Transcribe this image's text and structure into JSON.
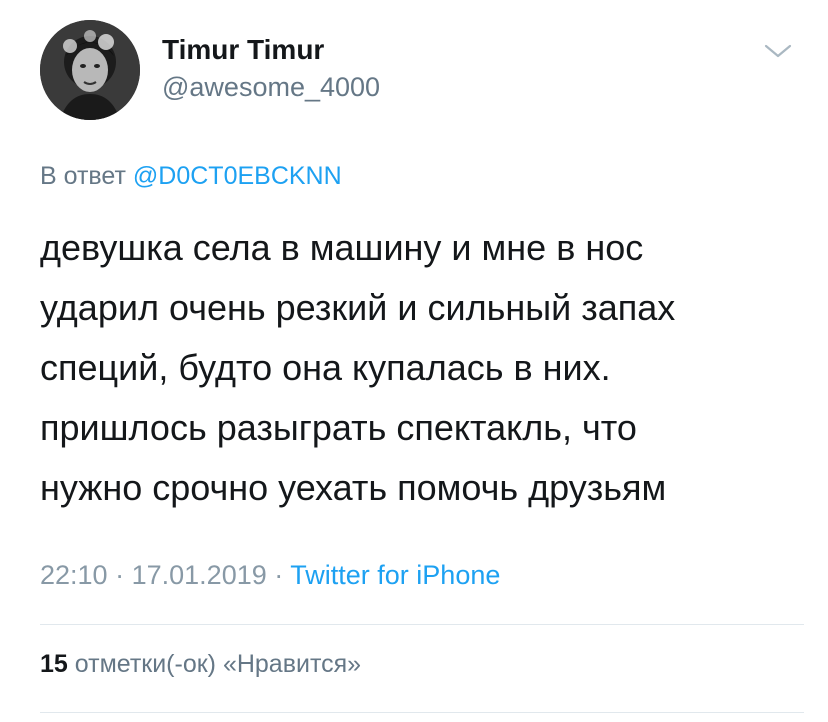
{
  "author": {
    "name": "Timur Timur",
    "handle": "@awesome_4000"
  },
  "reply": {
    "prefix": "В ответ",
    "mention": "@D0CT0EBCKNN"
  },
  "tweet": {
    "lines": [
      "девушка села в машину и мне в нос",
      "ударил очень резкий и сильный запах",
      "специй, будто она купалась в них.",
      "пришлось разыграть спектакль, что",
      "нужно срочно уехать помочь друзьям"
    ]
  },
  "meta": {
    "time": "22:10",
    "separator": "·",
    "date": "17.01.2019",
    "source": "Twitter for iPhone"
  },
  "likes": {
    "count": "15",
    "label": "отметки(-ок) «Нравится»"
  },
  "icons": {
    "menu": "chevron-down-icon",
    "avatar": "avatar"
  },
  "colors": {
    "accent": "#1da1f2",
    "secondary": "#657786",
    "text": "#14171a"
  }
}
